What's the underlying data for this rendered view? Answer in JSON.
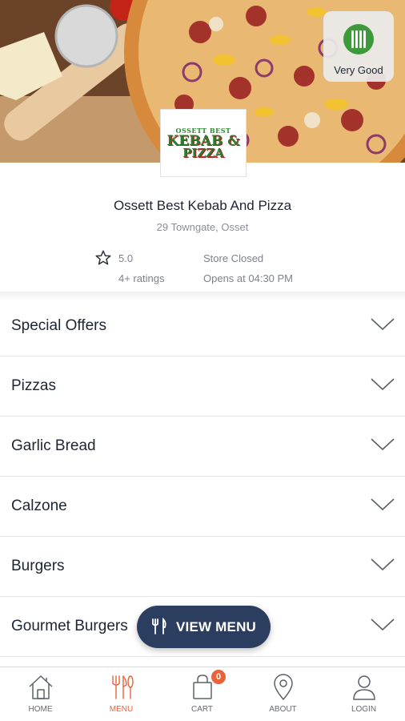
{
  "hero": {
    "hygiene_label": "Very Good",
    "logo_lines": [
      "OSSETT BEST",
      "KEBAB &",
      "PIZZA"
    ]
  },
  "store": {
    "name": "Ossett Best Kebab And Pizza",
    "address": "29 Towngate, Osset",
    "rating": "5.0",
    "ratings_count": "4+ ratings",
    "status": "Store Closed",
    "opens_at": "Opens at 04:30 PM"
  },
  "categories": [
    {
      "label": "Special Offers"
    },
    {
      "label": "Pizzas"
    },
    {
      "label": "Garlic Bread"
    },
    {
      "label": "Calzone"
    },
    {
      "label": "Burgers"
    },
    {
      "label": "Gourmet Burgers"
    }
  ],
  "view_menu": {
    "label": "VIEW MENU",
    "icon": "cutlery-icon"
  },
  "bottom_nav": {
    "items": [
      {
        "label": "HOME",
        "icon": "home-icon"
      },
      {
        "label": "MENU",
        "icon": "cutlery-icon",
        "active": true
      },
      {
        "label": "CART",
        "icon": "bag-icon",
        "badge": "0"
      },
      {
        "label": "ABOUT",
        "icon": "location-pin-icon"
      },
      {
        "label": "LOGIN",
        "icon": "user-icon"
      }
    ]
  },
  "colors": {
    "accent": "#e8623a",
    "navy": "#2c3e5f",
    "hygiene_green": "#3c9a3a"
  }
}
